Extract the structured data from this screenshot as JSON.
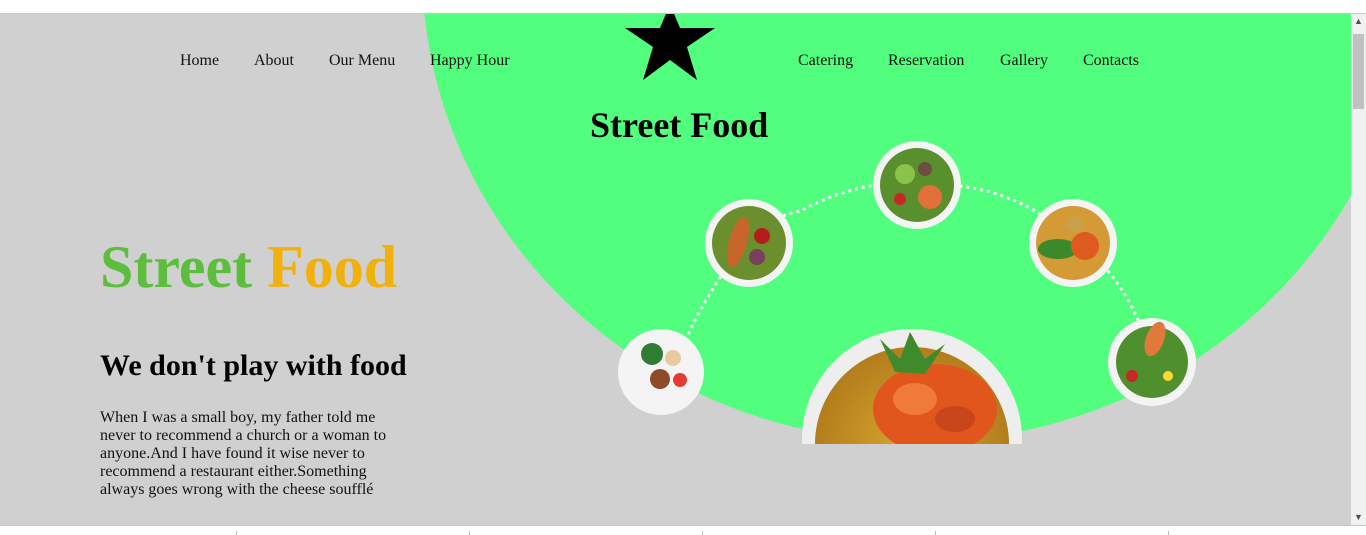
{
  "nav": {
    "left": [
      "Home",
      "About",
      "Our Menu",
      "Happy Hour"
    ],
    "right": [
      "Catering",
      "Reservation",
      "Gallery",
      "Contacts"
    ]
  },
  "hero": {
    "title": "Street Food"
  },
  "brand": {
    "word1": "Street",
    "word2": "Food",
    "color1": "#5cbe3c",
    "color2": "#f0b20a"
  },
  "tagline": "We don't play with food",
  "blurb": "When I was a small boy, my father told me never to recommend a church or a woman to anyone.And I have found it wise never to recommend a restaurant either.Something always goes wrong with the cheese soufflé",
  "colors": {
    "background": "#d0d0d0",
    "accent_green": "#52fe7d"
  },
  "icons": {
    "logo": "star-icon"
  }
}
